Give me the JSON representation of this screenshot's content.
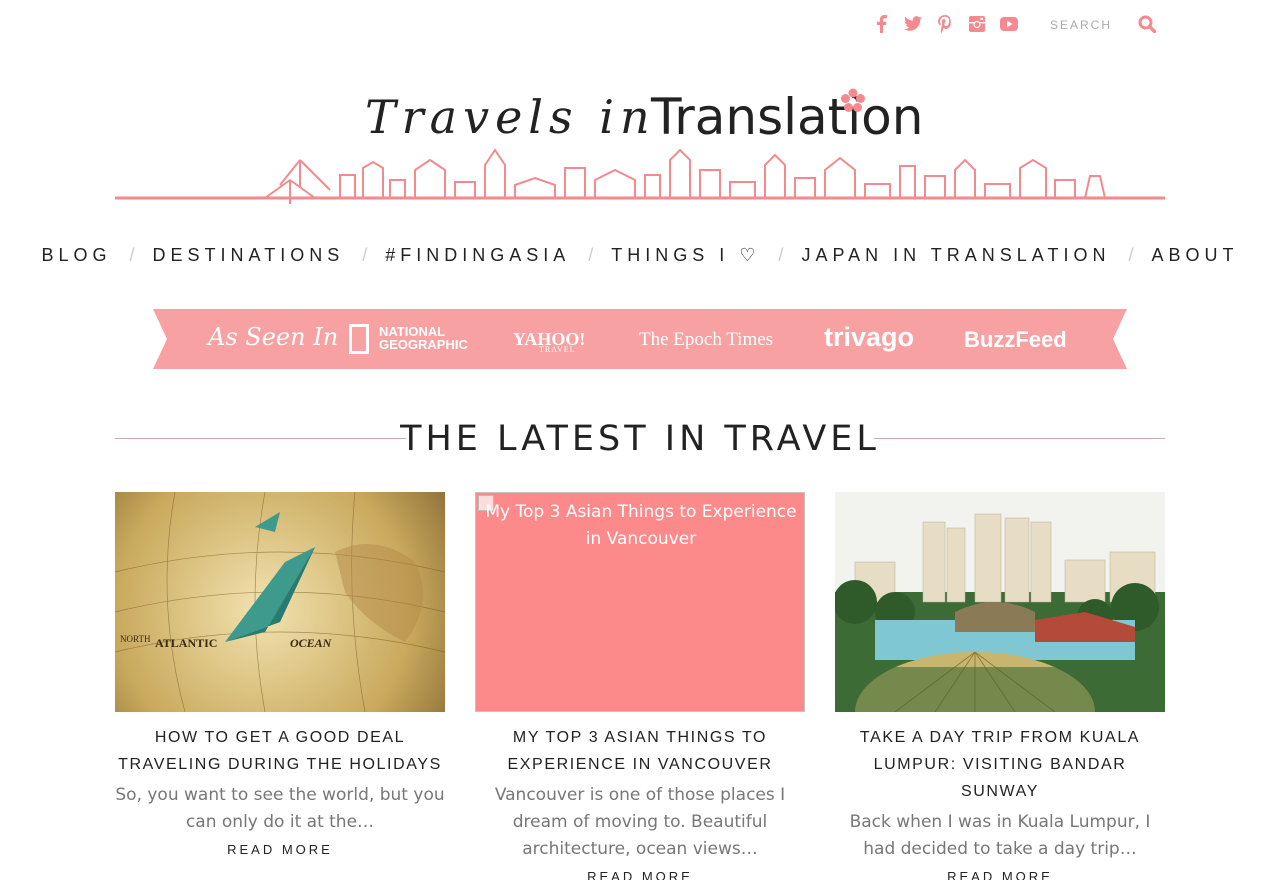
{
  "colors": {
    "accent": "#f48a8d",
    "banner": "#f7a1a3",
    "broken_image": "#fd8a8b",
    "text": "#222222",
    "muted": "#777777"
  },
  "social": [
    {
      "icon": "facebook-icon",
      "glyph": "f"
    },
    {
      "icon": "twitter-icon",
      "glyph": "t"
    },
    {
      "icon": "pinterest-icon",
      "glyph": "p"
    },
    {
      "icon": "instagram-icon",
      "glyph": "◘"
    },
    {
      "icon": "youtube-icon",
      "glyph": "▶"
    }
  ],
  "search": {
    "placeholder": "SEARCH",
    "icon": "search-icon"
  },
  "logo": {
    "script": "Travels in",
    "main": "Translation"
  },
  "nav": {
    "items": [
      "BLOG",
      "DESTINATIONS",
      "#FINDINGASIA",
      "THINGS I ♡",
      "JAPAN IN TRANSLATION",
      "ABOUT"
    ],
    "separator": "/"
  },
  "banner": {
    "as_seen_in": "As Seen In",
    "natgeo_1": "NATIONAL",
    "natgeo_2": "GEOGRAPHIC",
    "yahoo": "YAHOO!",
    "yahoo_sub": "TRAVEL",
    "epoch": "The Epoch Times",
    "trivago": "trivago",
    "buzzfeed": "BuzzFeed"
  },
  "section": {
    "title": "THE LATEST IN TRAVEL"
  },
  "posts": [
    {
      "title": "HOW TO GET A GOOD DEAL TRAVELING DURING THE HOLIDAYS",
      "excerpt": "So, you want to see the world, but you can only do it at the…",
      "more": "READ MORE"
    },
    {
      "image_alt": "My Top 3 Asian Things to Experience in Vancouver",
      "title": "MY TOP 3 ASIAN THINGS TO EXPERIENCE IN VANCOUVER",
      "excerpt": "Vancouver is one of those places I dream of moving to. Beautiful architecture, ocean views…",
      "more": "READ MORE"
    },
    {
      "title": "TAKE A DAY TRIP FROM KUALA LUMPUR: VISITING BANDAR SUNWAY",
      "excerpt": "Back when I was in Kuala Lumpur, I had decided to take a day trip…",
      "more": "READ MORE"
    }
  ]
}
